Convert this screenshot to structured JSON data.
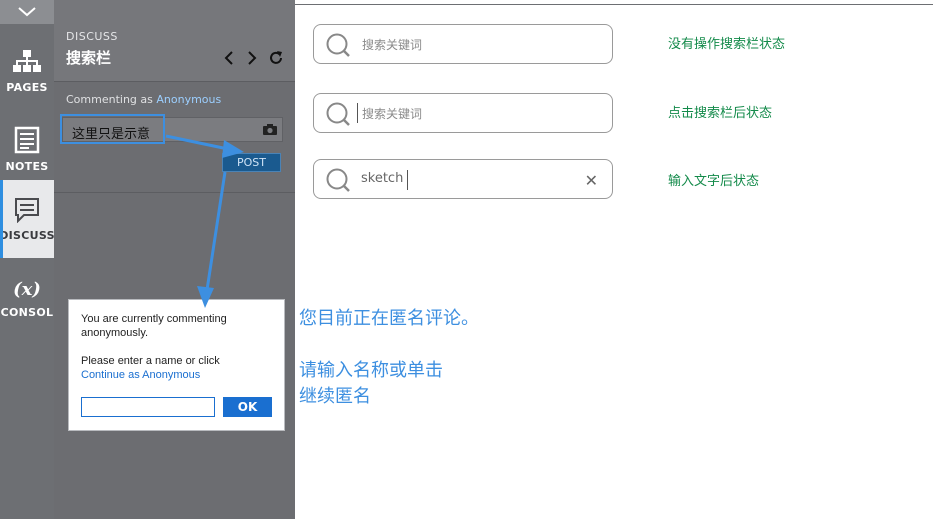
{
  "rail": {
    "items": [
      {
        "label": "PAGES",
        "icon": "sitemap-icon",
        "active": false
      },
      {
        "label": "NOTES",
        "icon": "notes-icon",
        "active": false
      },
      {
        "label": "DISCUSS",
        "icon": "comment-icon",
        "active": true
      },
      {
        "label": "CONSOL",
        "icon": "fx-icon",
        "glyph": "(x)",
        "active": false
      }
    ]
  },
  "panel": {
    "kicker": "DISCUSS",
    "title": "搜索栏",
    "commenting_prefix": "Commenting as",
    "commenting_user": "Anonymous",
    "comment_text": "这里只是示意",
    "post_label": "POST"
  },
  "dialog": {
    "line1": "You are currently commenting",
    "line2": "anonymously.",
    "line3": "Please enter a name or click",
    "link": "Continue as Anonymous",
    "name_value": "",
    "ok_label": "OK"
  },
  "searches": [
    {
      "placeholder": "搜索关键词",
      "value": "",
      "focused": false,
      "clear": false,
      "label": "没有操作搜索栏状态"
    },
    {
      "placeholder": "搜索关键词",
      "value": "",
      "focused": true,
      "clear": false,
      "label": "点击搜索栏后状态"
    },
    {
      "placeholder": "",
      "value": "sketch",
      "focused": true,
      "clear": true,
      "label": "输入文字后状态"
    }
  ],
  "notes": {
    "line1": "您目前正在匿名评论。",
    "line2": "请输入名称或单击",
    "line3": "继续匿名"
  },
  "colors": {
    "accent": "#3d8fe0",
    "state_label": "#138a4a",
    "rail_bg": "#6d6f73",
    "panel_bg": "#6c6d71"
  }
}
